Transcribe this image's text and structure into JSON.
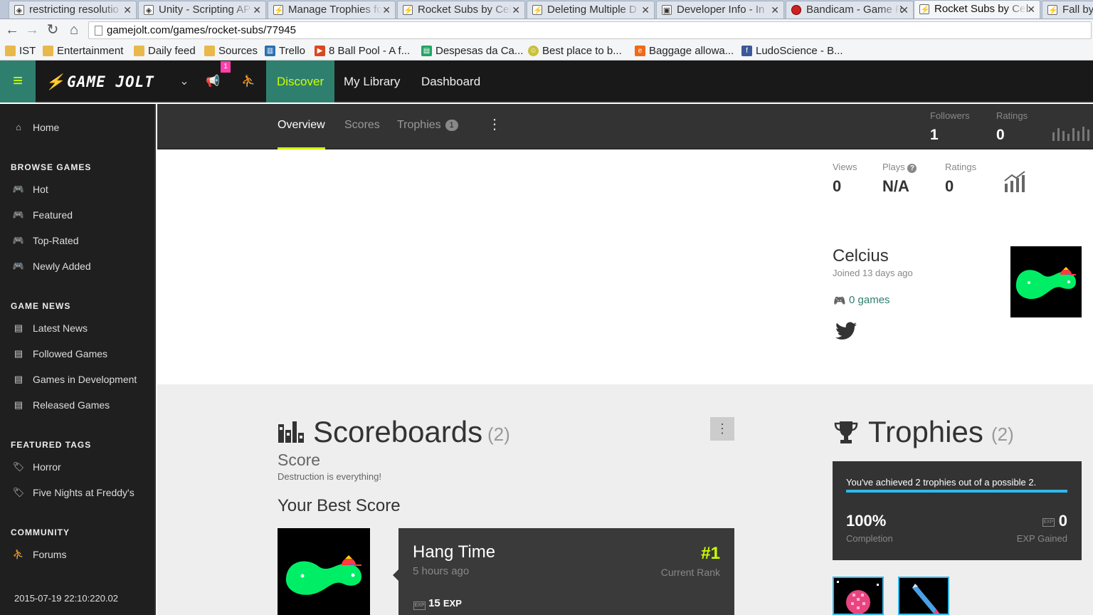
{
  "browser": {
    "tabs": [
      {
        "title": "restricting resolutio",
        "icon": "unity-icon"
      },
      {
        "title": "Unity - Scripting AP",
        "icon": "unity-icon"
      },
      {
        "title": "Manage Trophies fo",
        "icon": "gamejolt-icon"
      },
      {
        "title": "Rocket Subs by Cel",
        "icon": "gamejolt-icon"
      },
      {
        "title": "Deleting Multiple D",
        "icon": "gamejolt-icon"
      },
      {
        "title": "Developer Info - In",
        "icon": "indiedb-icon"
      },
      {
        "title": "Bandicam - Game R",
        "icon": "bandicam-icon"
      },
      {
        "title": "Rocket Subs by Cel",
        "icon": "gamejolt-icon",
        "active": true
      },
      {
        "title": "Fall by",
        "icon": "gamejolt-icon"
      }
    ],
    "url": "gamejolt.com/games/rocket-subs/77945",
    "bookmarks": [
      {
        "label": "IST",
        "icon": "folder-icon"
      },
      {
        "label": "Entertainment",
        "icon": "folder-icon"
      },
      {
        "label": "Daily feed",
        "icon": "folder-icon"
      },
      {
        "label": "Sources",
        "icon": "folder-icon"
      },
      {
        "label": "Trello",
        "icon": "trello-icon"
      },
      {
        "label": "8 Ball Pool - A f...",
        "icon": "youtube-icon"
      },
      {
        "label": "Despesas da Ca...",
        "icon": "sheets-icon"
      },
      {
        "label": "Best place to b...",
        "icon": "smiley-icon"
      },
      {
        "label": "Baggage allowa...",
        "icon": "easyjet-icon"
      },
      {
        "label": "LudoScience - B...",
        "icon": "facebook-icon"
      }
    ]
  },
  "header": {
    "logo": "GAME JOLT",
    "notification_count": "1",
    "nav": [
      "Discover",
      "My Library",
      "Dashboard"
    ]
  },
  "sidebar": {
    "home": "Home",
    "sections": [
      {
        "title": "BROWSE GAMES",
        "items": [
          "Hot",
          "Featured",
          "Top-Rated",
          "Newly Added"
        ]
      },
      {
        "title": "GAME NEWS",
        "items": [
          "Latest News",
          "Followed Games",
          "Games in Development",
          "Released Games"
        ]
      },
      {
        "title": "FEATURED TAGS",
        "items": [
          "Horror",
          "Five Nights at Freddy's"
        ]
      },
      {
        "title": "COMMUNITY",
        "items": [
          "Forums"
        ]
      }
    ]
  },
  "timestamp": "2015-07-19 22:10:220.02",
  "subnav": {
    "tabs": [
      "Overview",
      "Scores",
      "Trophies"
    ],
    "trophies_count": "1",
    "followers_label": "Followers",
    "followers_value": "1",
    "ratings_label": "Ratings",
    "ratings_value": "0"
  },
  "stats": {
    "views_label": "Views",
    "views_value": "0",
    "plays_label": "Plays",
    "plays_value": "N/A",
    "ratings_label": "Ratings",
    "ratings_value": "0"
  },
  "developer": {
    "name": "Celcius",
    "joined": "Joined 13 days ago",
    "games": "0 games"
  },
  "scoreboards": {
    "title": "Scoreboards",
    "count": "(2)",
    "score_name": "Score",
    "score_desc": "Destruction is everything!",
    "best_title": "Your Best Score",
    "best": {
      "name": "Hang Time",
      "time": "5 hours ago",
      "rank": "#1",
      "rank_label": "Current Rank",
      "exp": "15",
      "exp_unit": "EXP"
    }
  },
  "trophies": {
    "title": "Trophies",
    "count": "(2)",
    "summary": "You've achieved 2 trophies out of a possible 2.",
    "progress": 1.0,
    "completion_value": "100%",
    "completion_label": "Completion",
    "exp_value": "0",
    "exp_label": "EXP Gained"
  },
  "colors": {
    "accent": "#ccff00",
    "teal": "#2f7f6f",
    "trophy_blue": "#2fb7ec"
  }
}
